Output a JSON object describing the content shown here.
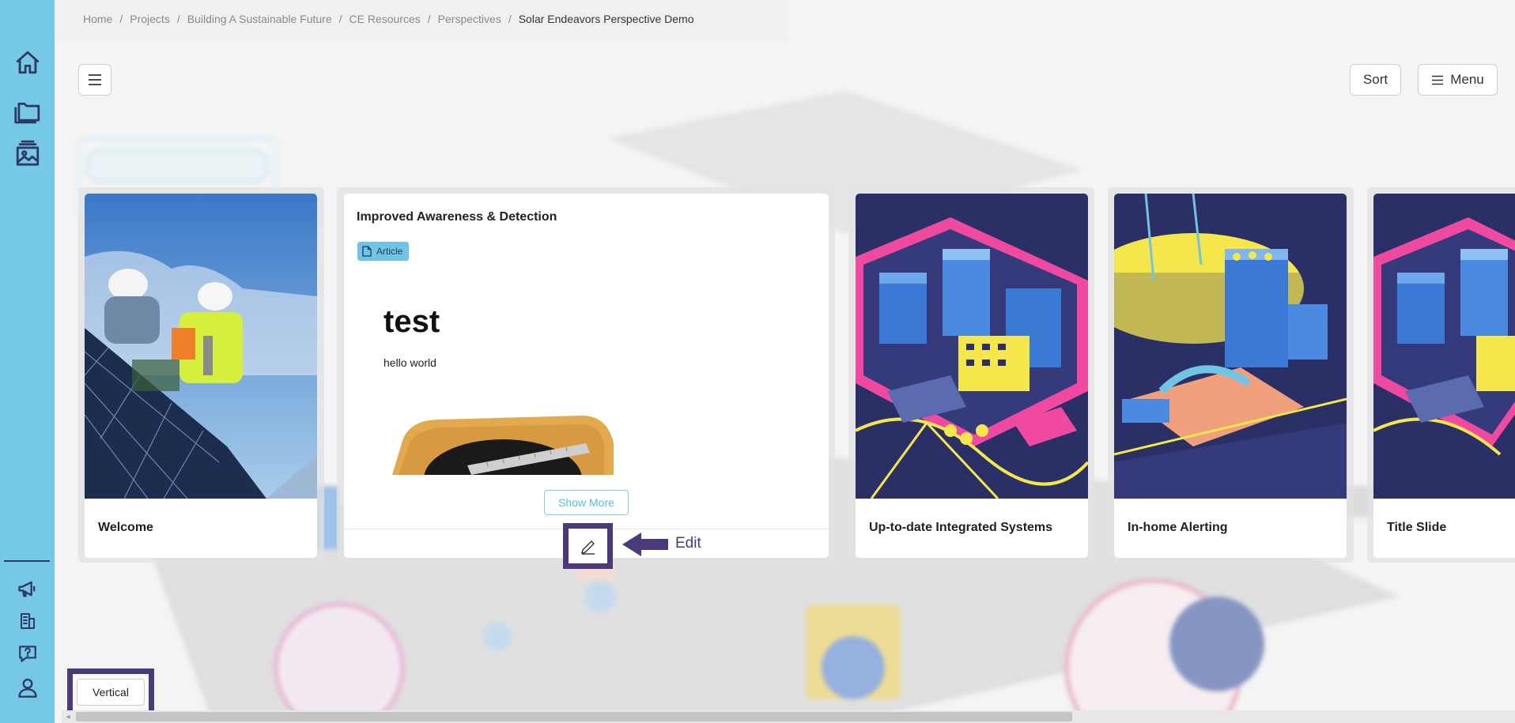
{
  "breadcrumb": {
    "items": [
      "Home",
      "Projects",
      "Building A Sustainable Future",
      "CE Resources",
      "Perspectives"
    ],
    "separator": "/",
    "current": "Solar Endeavors Perspective Demo"
  },
  "toolbar": {
    "sort_label": "Sort",
    "menu_label": "Menu"
  },
  "cards": {
    "welcome": {
      "title": "Welcome"
    },
    "article": {
      "title": "Improved Awareness & Detection",
      "badge": "Article",
      "heading": "test",
      "body": "hello world",
      "show_more": "Show More"
    },
    "integrated": {
      "title": "Up-to-date Integrated Systems"
    },
    "alerting": {
      "title": "In-home Alerting"
    },
    "title_slide": {
      "title": "Title Slide"
    }
  },
  "annotations": {
    "edit_label": "Edit"
  },
  "layout_toggle": {
    "label": "Vertical"
  },
  "colors": {
    "sidebar": "#75c9e6",
    "highlight": "#4a3a7a",
    "badge": "#6fc5e3",
    "city_bg": "#2a2f66",
    "city_pink": "#f04aa0",
    "city_yellow": "#f5e64c",
    "city_blue": "#3a7ad6"
  },
  "icons": {
    "sidebar_top": [
      "home-icon",
      "folder-icon",
      "gallery-icon"
    ],
    "sidebar_bottom": [
      "megaphone-icon",
      "building-icon",
      "help-icon",
      "user-icon"
    ]
  }
}
